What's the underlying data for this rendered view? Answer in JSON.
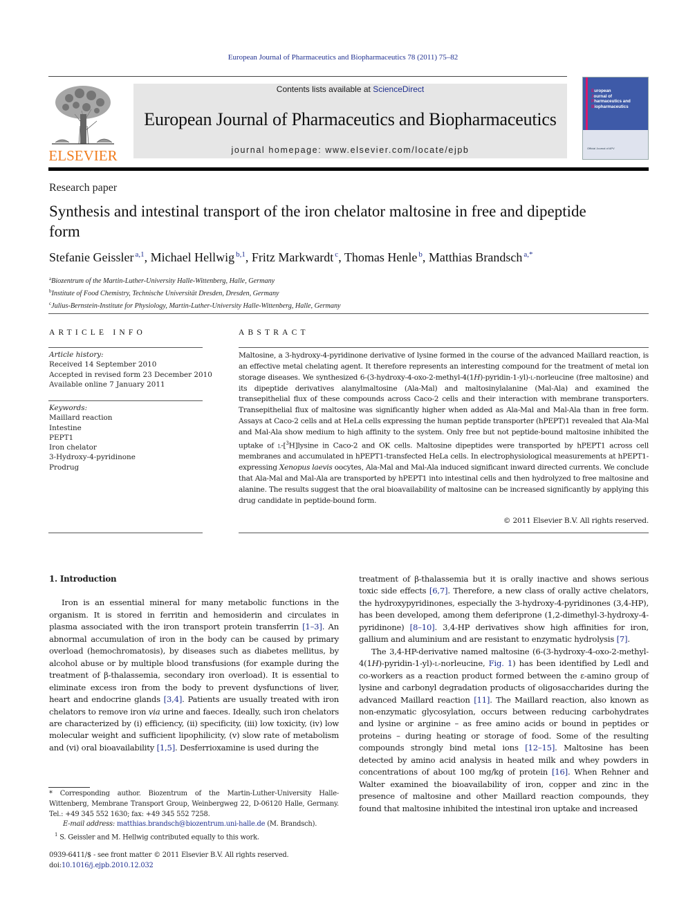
{
  "header": {
    "journal_reference": "European Journal of Pharmaceutics and Biopharmaceutics 78 (2011) 75–82",
    "contents_prefix": "Contents lists available at ",
    "contents_link": "ScienceDirect",
    "journal_title": "European Journal of Pharmaceutics and Biopharmaceutics",
    "homepage": "journal homepage: www.elsevier.com/locate/ejpb",
    "publisher_logo_text": "ELSEVIER",
    "cover": {
      "title_lines": [
        {
          "cap": "E",
          "rest": "uropean"
        },
        {
          "cap": "J",
          "rest": "ournal of"
        },
        {
          "cap": "P",
          "rest": "harmaceutics and"
        },
        {
          "cap": "B",
          "rest": "iopharmaceutics"
        }
      ],
      "footer": "Official Journal of APV"
    },
    "colors": {
      "link": "#1f2f8f",
      "elsevier_orange": "#f07c1d",
      "banner_bg": "#e6e6e6",
      "cover_blue": "#3e5aa8",
      "cover_magenta": "#d8186c"
    }
  },
  "article": {
    "type": "Research paper",
    "title": "Synthesis and intestinal transport of the iron chelator maltosine in free and dipeptide form",
    "authors": [
      {
        "name": "Stefanie Geissler",
        "marks": "a,1"
      },
      {
        "name": "Michael Hellwig",
        "marks": "b,1"
      },
      {
        "name": "Fritz Markwardt",
        "marks": "c"
      },
      {
        "name": "Thomas Henle",
        "marks": "b"
      },
      {
        "name": "Matthias Brandsch",
        "marks": "a,*"
      }
    ],
    "affiliations": [
      {
        "mark": "a",
        "text": "Biozentrum of the Martin-Luther-University Halle-Wittenberg, Halle, Germany"
      },
      {
        "mark": "b",
        "text": "Institute of Food Chemistry, Technische Universität Dresden, Dresden, Germany"
      },
      {
        "mark": "c",
        "text": "Julius-Bernstein-Institute for Physiology, Martin-Luther-University Halle-Wittenberg, Halle, Germany"
      }
    ]
  },
  "article_info": {
    "heading": "ARTICLE INFO",
    "history_label": "Article history:",
    "history": [
      "Received 14 September 2010",
      "Accepted in revised form 23 December 2010",
      "Available online 7 January 2011"
    ],
    "keywords_label": "Keywords:",
    "keywords": [
      "Maillard reaction",
      "Intestine",
      "PEPT1",
      "Iron chelator",
      "3-Hydroxy-4-pyridinone",
      "Prodrug"
    ]
  },
  "abstract": {
    "heading": "ABSTRACT",
    "text": "Maltosine, a 3-hydroxy-4-pyridinone derivative of lysine formed in the course of the advanced Maillard reaction, is an effective metal chelating agent. It therefore represents an interesting compound for the treatment of metal ion storage diseases. We synthesized 6-(3-hydroxy-4-oxo-2-methyl-4(1H)-pyridin-1-yl)-L-norleucine (free maltosine) and its dipeptide derivatives alanylmaltosine (Ala-Mal) and maltosinylalanine (Mal-Ala) and examined the transepithelial flux of these compounds across Caco-2 cells and their interaction with membrane transporters. Transepithelial flux of maltosine was significantly higher when added as Ala-Mal and Mal-Ala than in free form. Assays at Caco-2 cells and at HeLa cells expressing the human peptide transporter (hPEPT)1 revealed that Ala-Mal and Mal-Ala show medium to high affinity to the system. Only free but not peptide-bound maltosine inhibited the uptake of L-[3H]lysine in Caco-2 and OK cells. Maltosine dipeptides were transported by hPEPT1 across cell membranes and accumulated in hPEPT1-transfected HeLa cells. In electrophysiological measurements at hPEPT1-expressing Xenopus laevis oocytes, Ala-Mal and Mal-Ala induced significant inward directed currents. We conclude that Ala-Mal and Mal-Ala are transported by hPEPT1 into intestinal cells and then hydrolyzed to free maltosine and alanine. The results suggest that the oral bioavailability of maltosine can be increased significantly by applying this drug candidate in peptide-bound form.",
    "parts": {
      "p1": "Maltosine, a 3-hydroxy-4-pyridinone derivative of lysine formed in the course of the advanced Maillard reaction, is an effective metal chelating agent. It therefore represents an interesting compound for the treatment of metal ion storage diseases. We synthesized 6-(3-hydroxy-4-oxo-2-methyl-4(1",
      "p1_italic": "H",
      "p2": ")-pyridin-1-yl)-",
      "p2_sc": "l",
      "p3": "-norleucine (free maltosine) and its dipeptide derivatives alanylmaltosine (Ala-Mal) and maltosinylalanine (Mal-Ala) and examined the transepithelial flux of these compounds across Caco-2 cells and their interaction with membrane transporters. Transepithelial flux of maltosine was significantly higher when added as Ala-Mal and Mal-Ala than in free form. Assays at Caco-2 cells and at HeLa cells expressing the human peptide transporter (hPEPT)1 revealed that Ala-Mal and Mal-Ala show medium to high affinity to the system. Only free but not peptide-bound maltosine inhibited the uptake of ",
      "p3_sc": "l",
      "p4": "-[",
      "p4_sup": "3",
      "p5": "H]lysine in Caco-2 and OK cells. Maltosine dipeptides were transported by hPEPT1 across cell membranes and accumulated in hPEPT1-transfected HeLa cells. In electrophysiological measurements at hPEPT1-expressing ",
      "p5_italic": "Xenopus laevis",
      "p6": " oocytes, Ala-Mal and Mal-Ala induced significant inward directed currents. We conclude that Ala-Mal and Mal-Ala are transported by hPEPT1 into intestinal cells and then hydrolyzed to free maltosine and alanine. The results suggest that the oral bioavailability of maltosine can be increased significantly by applying this drug candidate in peptide-bound form."
    },
    "copyright": "© 2011 Elsevier B.V. All rights reserved."
  },
  "body": {
    "section_heading": "1. Introduction",
    "left": {
      "s1": "Iron is an essential mineral for many metabolic functions in the organism. It is stored in ferritin and hemosiderin and circulates in plasma associated with the iron transport protein transferrin ",
      "r1": "[1–3]",
      "s2": ". An abnormal accumulation of iron in the body can be caused by primary overload (hemochromatosis), by diseases such as diabetes mellitus, by alcohol abuse or by multiple blood transfusions (for example during the treatment of β-thalassemia, secondary iron overload). It is essential to eliminate excess iron from the body to prevent dysfunctions of liver, heart and endocrine glands ",
      "r2": "[3,4]",
      "s3": ". Patients are usually treated with iron chelators to remove iron ",
      "s3_italic": "via",
      "s4": " urine and faeces. Ideally, such iron chelators are characterized by (i) efficiency, (ii) specificity, (iii) low toxicity, (iv) low molecular weight and sufficient lipophilicity, (v) slow rate of metabolism and (vi) oral bioavailability ",
      "r3": "[1,5]",
      "s5": ". Desferrioxamine is used during the"
    },
    "right": {
      "a1": "treatment of β-thalassemia but it is orally inactive and shows serious toxic side effects ",
      "ra1": "[6,7]",
      "a2": ". Therefore, a new class of orally active chelators, the hydroxypyridinones, especially the 3-hydroxy-4-pyridinones (3,4-HP), has been developed, among them deferiprone (1,2-dimethyl-3-hydroxy-4-pyridinone) ",
      "ra2": "[8–10]",
      "a3": ". 3,4-HP derivatives show high affinities for iron, gallium and aluminium and are resistant to enzymatic hydrolysis ",
      "ra3": "[7]",
      "a4": ".",
      "b1": "The 3,4-HP-derivative named maltosine (6-(3-hydroxy-4-oxo-2-methyl-4(1",
      "b1_italic": "H",
      "b2": ")-pyridin-1-yl)-",
      "b2_sc": "l",
      "b3": "-norleucine, ",
      "rb_fig": "Fig. 1",
      "b4": ") has been identified by Ledl and co-workers as a reaction product formed between the ε-amino group of lysine and carbonyl degradation products of oligosaccharides during the advanced Maillard reaction ",
      "rb1": "[11]",
      "b5": ". The Maillard reaction, also known as non-enzymatic glycosylation, occurs between reducing carbohydrates and lysine or arginine – as free amino acids or bound in peptides or proteins – during heating or storage of food. Some of the resulting compounds strongly bind metal ions ",
      "rb2": "[12–15]",
      "b6": ". Maltosine has been detected by amino acid analysis in heated milk and whey powders in concentrations of about 100 mg/kg of protein ",
      "rb3": "[16]",
      "b7": ". When Rehner and Walter examined the bioavailability of iron, copper and zinc in the presence of maltosine and other Maillard reaction compounds, they found that maltosine inhibited the intestinal iron uptake and increased"
    }
  },
  "footnotes": {
    "corresponding": "* Corresponding author. Biozentrum of the Martin-Luther-University Halle-Wittenberg, Membrane Transport Group, Weinbergweg 22, D-06120 Halle, Germany. Tel.: +49 345 552 1630; fax: +49 345 552 7258.",
    "email_label": "E-mail address: ",
    "email": "matthias.brandsch@biozentrum.uni-halle.de",
    "email_suffix": " (M. Brandsch).",
    "equal_mark": "1",
    "equal_contribution": " S. Geissler and M. Hellwig contributed equally to this work.",
    "front_matter": "0939-6411/$ - see front matter © 2011 Elsevier B.V. All rights reserved.",
    "doi_prefix": "doi:",
    "doi": "10.1016/j.ejpb.2010.12.032"
  }
}
